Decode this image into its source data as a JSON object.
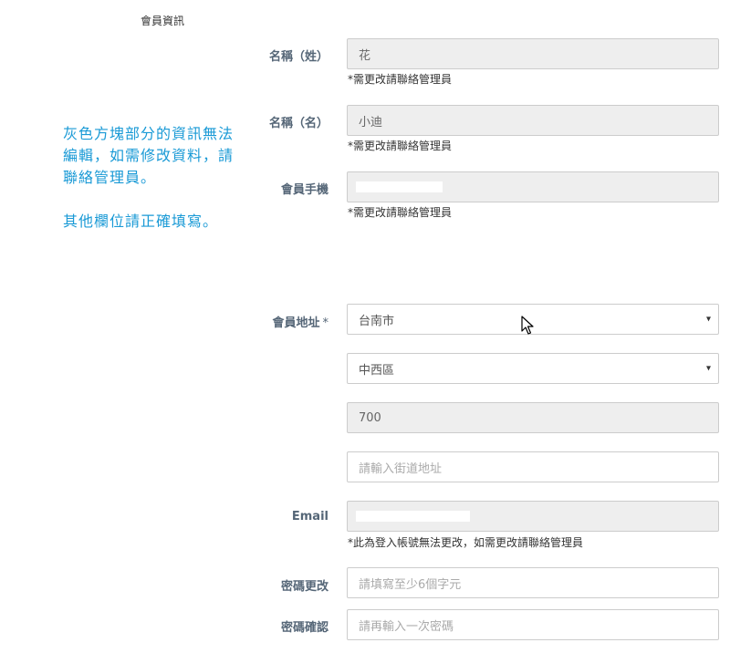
{
  "section_title": "會員資訊",
  "notice": {
    "line1": "灰色方塊部分的資訊無法編輯，如需修改資料，請聯絡管理員。",
    "line2": "其他欄位請正確填寫。"
  },
  "fields": {
    "last_name": {
      "label": "名稱（姓）",
      "value": "花",
      "hint": "*需更改請聯絡管理員"
    },
    "first_name": {
      "label": "名稱（名）",
      "value": "小迪",
      "hint": "*需更改請聯絡管理員"
    },
    "mobile": {
      "label": "會員手機",
      "value": "",
      "hint": "*需更改請聯絡管理員"
    },
    "address": {
      "label": "會員地址",
      "required_mark": "*",
      "city": "台南市",
      "district": "中西區",
      "zip": "700",
      "street_placeholder": "請輸入街道地址"
    },
    "email": {
      "label": "Email",
      "value": "",
      "hint": "*此為登入帳號無法更改，如需更改請聯絡管理員"
    },
    "password": {
      "label": "密碼更改",
      "placeholder": "請填寫至少6個字元"
    },
    "password_confirm": {
      "label": "密碼確認",
      "placeholder": "請再輸入一次密碼"
    }
  },
  "icons": {
    "select_arrow": "▾"
  }
}
